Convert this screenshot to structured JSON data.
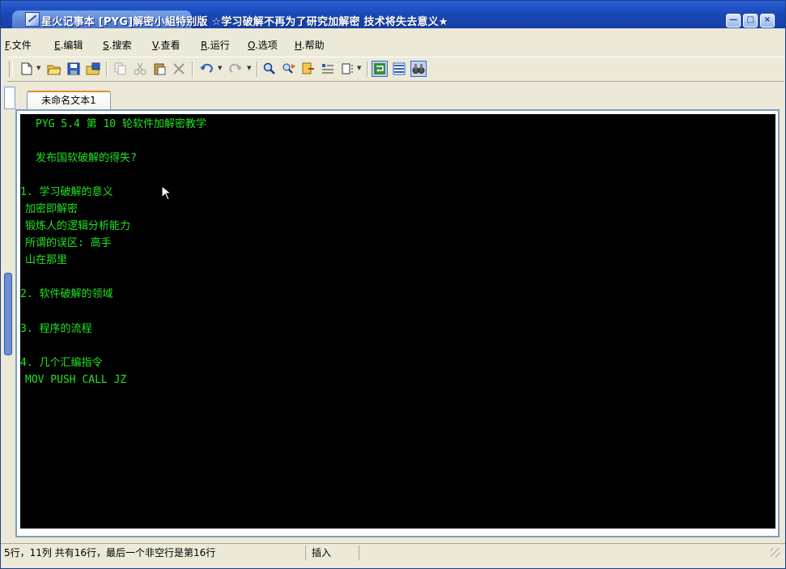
{
  "window": {
    "title": "星火记事本 [PYG]解密小組特别版 ☆学习破解不再为了研究加解密 技术将失去意义★",
    "buttons": {
      "minimize": "—",
      "maximize": "□",
      "close": "×"
    }
  },
  "menu": {
    "items": [
      {
        "key": "F",
        "label": ".文件"
      },
      {
        "key": "E",
        "label": ".编辑"
      },
      {
        "key": "S",
        "label": ".搜索"
      },
      {
        "key": "V",
        "label": ".查看"
      },
      {
        "key": "R",
        "label": ".运行"
      },
      {
        "key": "O",
        "label": ".选项"
      },
      {
        "key": "H",
        "label": ".帮助"
      }
    ]
  },
  "toolbar": {
    "icons": [
      "new-file-icon",
      "open-folder-icon",
      "save-icon",
      "save-all-icon",
      "copy-icon",
      "cut-icon",
      "paste-icon",
      "delete-icon",
      "undo-icon",
      "redo-icon",
      "find-icon",
      "replace-icon",
      "goto-icon",
      "format-icon",
      "column-icon",
      "wrap-icon",
      "view-icon",
      "binoculars-icon"
    ]
  },
  "tabs": [
    {
      "label": "未命名文本1",
      "active": true
    }
  ],
  "editor": {
    "lines": [
      {
        "text": "PYG 5.4 第 10 轮软件加解密教学",
        "indent": 2
      },
      {
        "text": "",
        "indent": 0
      },
      {
        "text": "发布国软破解的得失?",
        "indent": 2
      },
      {
        "text": "",
        "indent": 0
      },
      {
        "text": "1. 学习破解的意义",
        "indent": 0
      },
      {
        "text": "加密即解密",
        "indent": 1
      },
      {
        "text": "锻炼人的逻辑分析能力",
        "indent": 1
      },
      {
        "text": "所谓的误区: 高手",
        "indent": 1
      },
      {
        "text": "山在那里",
        "indent": 1
      },
      {
        "text": "",
        "indent": 0
      },
      {
        "text": "2. 软件破解的领域",
        "indent": 0
      },
      {
        "text": "",
        "indent": 0
      },
      {
        "text": "3. 程序的流程",
        "indent": 0
      },
      {
        "text": "",
        "indent": 0
      },
      {
        "text": "4. 几个汇编指令",
        "indent": 0
      },
      {
        "text": "MOV PUSH CALL JZ",
        "indent": 1
      }
    ],
    "text_color": "#21e421",
    "background": "#000000"
  },
  "status": {
    "position": "5行，11列  共有16行，最后一个非空行是第16行",
    "mode": "插入"
  }
}
